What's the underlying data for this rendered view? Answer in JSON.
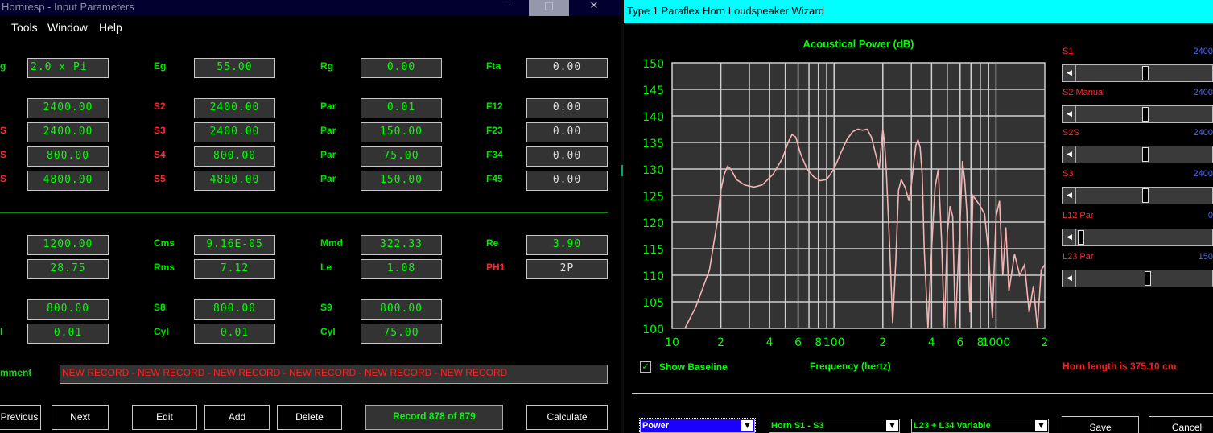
{
  "left": {
    "title": "Hornresp - Input Parameters",
    "menu": [
      "Tools",
      "Window",
      "Help"
    ],
    "window_buttons": {
      "minimize": "—",
      "maximize": "□",
      "close": "✕"
    },
    "labels": {
      "c1r1": "g",
      "eg": "Eg",
      "rg": "Rg",
      "fta": "Fta",
      "s2": "S2",
      "par1": "Par",
      "f12": "F12",
      "c1r3": "S",
      "s3": "S3",
      "par2": "Par",
      "f23": "F23",
      "c1r4": "S",
      "s4": "S4",
      "par3": "Par",
      "f34": "F34",
      "c1r5": "S",
      "s5": "S5",
      "par4": "Par",
      "f45": "F45",
      "cms": "Cms",
      "mmd": "Mmd",
      "re": "Re",
      "rms": "Rms",
      "le": "Le",
      "ph1": "PH1",
      "s8": "S8",
      "s9": "S9",
      "c1r9": "l",
      "cyl1": "Cyl",
      "cyl2": "Cyl",
      "comment": "mment"
    },
    "values": {
      "ang": "2.0 x Pi",
      "eg": "55.00",
      "rg": "0.00",
      "fta": "0.00",
      "s1": "2400.00",
      "s2": "2400.00",
      "par1": "0.01",
      "f12": "0.00",
      "s2b": "2400.00",
      "s3": "2400.00",
      "par2": "150.00",
      "f23": "0.00",
      "s3b": "800.00",
      "s4": "800.00",
      "par3": "75.00",
      "f34": "0.00",
      "s4b": "4800.00",
      "s5": "4800.00",
      "par4": "150.00",
      "f45": "0.00",
      "sd": "1200.00",
      "cms": "9.16E-05",
      "mmd": "322.33",
      "re": "3.90",
      "bl": "28.75",
      "rms": "7.12",
      "le": "1.08",
      "ph1": "2P",
      "s7": "800.00",
      "s8": "800.00",
      "s9": "800.00",
      "cyl0": "0.01",
      "cyl1": "0.01",
      "cyl2": "75.00"
    },
    "comment": "NEW RECORD - NEW RECORD - NEW RECORD - NEW RECORD - NEW RECORD - NEW RECORD",
    "buttons": {
      "previous": "Previous",
      "next": "Next",
      "edit": "Edit",
      "add": "Add",
      "delete": "Delete",
      "calculate": "Calculate"
    },
    "record": "Record 878 of 879"
  },
  "right": {
    "title": "Type 1 Paraflex Horn Loudspeaker Wizard",
    "show_baseline": "Show Baseline",
    "show_baseline_checked": true,
    "horn_length": "Horn length is 375.10 cm",
    "sliders": [
      {
        "label": "S1",
        "value": "2400",
        "position": 0.53
      },
      {
        "label": "S2  Manual",
        "value": "2400",
        "position": 0.53
      },
      {
        "label": "S2S",
        "value": "2400",
        "position": 0.53
      },
      {
        "label": "S3",
        "value": "2400",
        "position": 0.53
      },
      {
        "label": "L12  Par",
        "value": "0",
        "position": 0.0
      },
      {
        "label": "L23  Par",
        "value": "150",
        "position": 0.55
      }
    ],
    "dropdowns": {
      "mode": "Power",
      "horn": "Horn S1 - S3",
      "variable": "L23 + L34 Variable"
    },
    "buttons": {
      "save": "Save",
      "cancel": "Cancel"
    },
    "colors": {
      "trace": "#f4b3b3",
      "grid": "#d0d0d0",
      "plot_bg": "#333333",
      "label": "#00ff00"
    }
  },
  "chart_data": {
    "type": "line",
    "title": "Acoustical Power (dB)",
    "xlabel": "Frequency (hertz)",
    "ylabel": "",
    "xscale": "log",
    "xlim": [
      10,
      2000
    ],
    "ylim": [
      100,
      150
    ],
    "yticks": [
      100,
      105,
      110,
      115,
      120,
      125,
      130,
      135,
      140,
      145,
      150
    ],
    "xtick_labels": [
      {
        "f": 10,
        "label": "10"
      },
      {
        "f": 20,
        "label": "2"
      },
      {
        "f": 40,
        "label": "4"
      },
      {
        "f": 60,
        "label": "6"
      },
      {
        "f": 80,
        "label": "8"
      },
      {
        "f": 100,
        "label": "100"
      },
      {
        "f": 200,
        "label": "2"
      },
      {
        "f": 400,
        "label": "4"
      },
      {
        "f": 600,
        "label": "6"
      },
      {
        "f": 800,
        "label": "8"
      },
      {
        "f": 1000,
        "label": "1000"
      },
      {
        "f": 2000,
        "label": "2"
      }
    ],
    "grid": true,
    "series": [
      {
        "x": [
          12,
          14,
          17,
          19,
          20,
          21,
          22,
          23,
          25,
          28,
          32,
          36,
          42,
          48,
          52,
          55,
          58,
          62,
          68,
          75,
          82,
          90,
          100,
          110,
          120,
          130,
          140,
          150,
          160,
          170,
          180,
          190,
          200,
          205,
          210,
          220,
          230,
          240,
          250,
          260,
          275,
          290,
          300,
          310,
          320,
          330,
          340,
          350,
          360,
          380,
          400,
          420,
          440,
          460,
          480,
          500,
          520,
          540,
          560,
          580,
          600,
          620,
          640,
          660,
          690,
          720,
          760,
          800,
          850,
          900,
          950,
          1000,
          1050,
          1100,
          1150,
          1200,
          1300,
          1400,
          1500,
          1600,
          1700,
          1800,
          1900,
          2000
        ],
        "y": [
          100,
          104,
          111,
          120,
          126,
          129,
          130.5,
          130,
          128,
          127,
          126.6,
          127,
          129,
          132,
          135,
          136.5,
          136,
          133,
          130,
          128.5,
          127.8,
          128,
          130,
          133,
          135.5,
          137,
          137.5,
          137.3,
          137.5,
          136,
          133,
          130,
          137.5,
          135,
          130,
          116,
          101,
          112,
          126,
          128,
          126.5,
          124,
          127,
          131,
          134.5,
          135.5,
          134,
          129,
          115,
          100,
          115,
          126.5,
          130,
          117,
          100,
          118,
          123,
          121,
          100,
          110,
          120,
          131.5,
          128,
          122,
          103,
          125,
          124,
          123,
          121.5,
          114,
          102,
          121,
          124,
          110,
          119,
          107,
          114,
          110,
          112,
          103,
          108,
          100,
          111,
          112
        ]
      }
    ]
  }
}
